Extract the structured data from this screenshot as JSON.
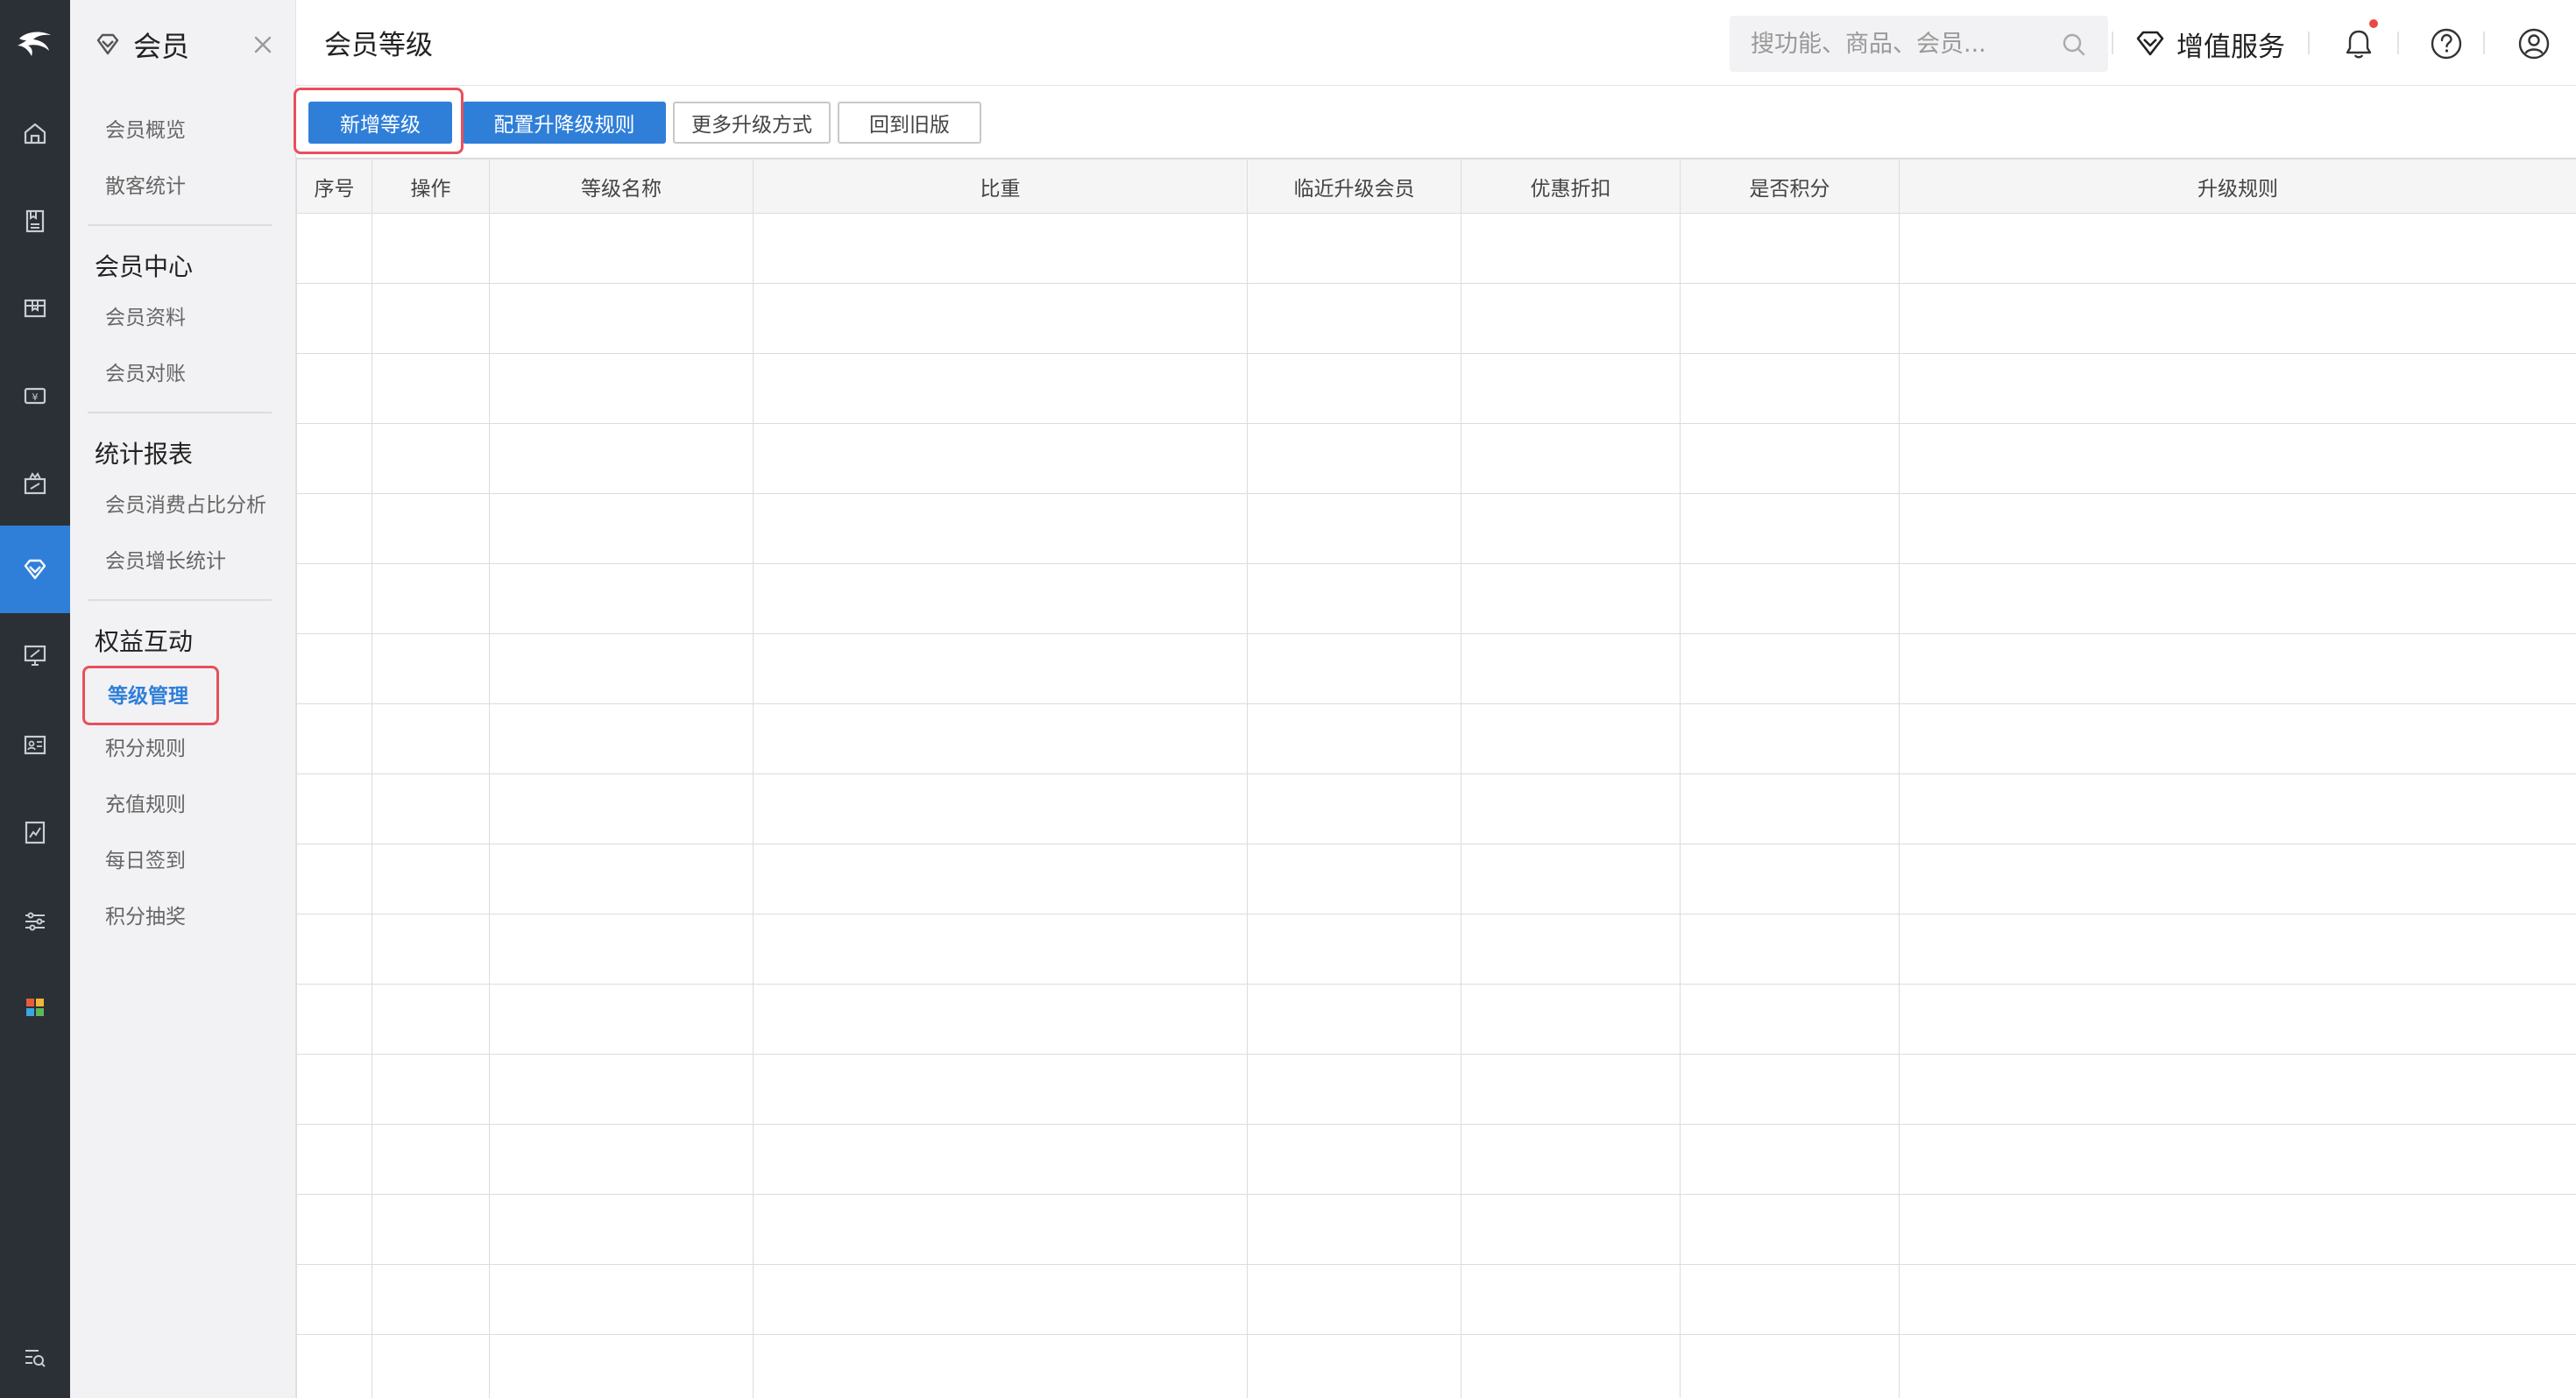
{
  "rail": {
    "items": [
      {
        "name": "home-icon"
      },
      {
        "name": "goods-icon"
      },
      {
        "name": "inventory-icon"
      },
      {
        "name": "finance-icon"
      },
      {
        "name": "marketing-icon"
      },
      {
        "name": "member-icon",
        "active": true
      },
      {
        "name": "sales-screen-icon"
      },
      {
        "name": "employee-card-icon"
      },
      {
        "name": "report-icon"
      },
      {
        "name": "settings-sliders-icon"
      },
      {
        "name": "apps-grid-icon"
      },
      {
        "name": "search-menu-icon"
      }
    ]
  },
  "sidebar": {
    "title": "会员",
    "top_items": [
      "会员概览",
      "散客统计"
    ],
    "groups": [
      {
        "title": "会员中心",
        "items": [
          "会员资料",
          "会员对账"
        ]
      },
      {
        "title": "统计报表",
        "items": [
          "会员消费占比分析",
          "会员增长统计"
        ]
      },
      {
        "title": "权益互动",
        "items": [
          "等级管理",
          "积分规则",
          "充值规则",
          "每日签到",
          "积分抽奖"
        ]
      }
    ],
    "active_item": "等级管理"
  },
  "header": {
    "page_title": "会员等级",
    "search_placeholder": "搜功能、商品、会员...",
    "value_added": "增值服务",
    "has_notification": true
  },
  "toolbar": {
    "add_level": "新增等级",
    "config_rules": "配置升降级规则",
    "more_methods": "更多升级方式",
    "back_old": "回到旧版"
  },
  "table": {
    "columns": [
      "序号",
      "操作",
      "等级名称",
      "比重",
      "临近升级会员",
      "优惠折扣",
      "是否积分",
      "升级规则"
    ],
    "rows": []
  },
  "colors": {
    "accent": "#2f7fd9",
    "rail_bg": "#2b2f36",
    "highlight": "#e8505b"
  }
}
